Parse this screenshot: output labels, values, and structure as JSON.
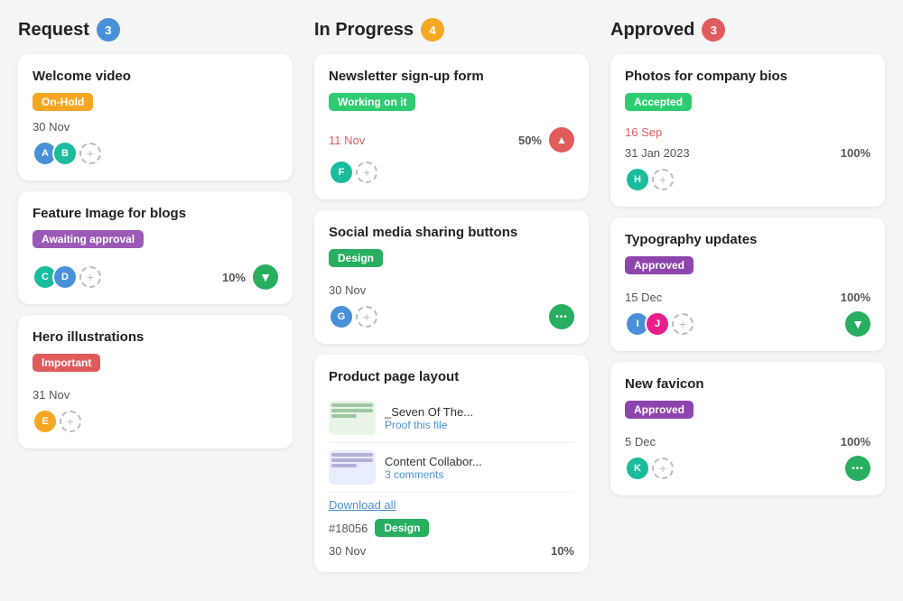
{
  "columns": [
    {
      "id": "request",
      "title": "Request",
      "badge_count": "3",
      "badge_color": "badge-blue",
      "cards": [
        {
          "id": "card-welcome-video",
          "title": "Welcome video",
          "tag_label": "On-Hold",
          "tag_color": "tag-orange",
          "date": "30 Nov",
          "date_style": "dark",
          "avatars": [
            {
              "color": "avatar-blue",
              "initial": "A"
            },
            {
              "color": "avatar-teal",
              "initial": "B"
            }
          ],
          "show_add": true,
          "show_percent": false,
          "percent": "",
          "icon": null
        },
        {
          "id": "card-feature-image",
          "title": "Feature Image for blogs",
          "tag_label": "Awaiting approval",
          "tag_color": "tag-purple",
          "date": "30 Nov",
          "date_style": "dark",
          "avatars": [
            {
              "color": "avatar-teal",
              "initial": "C"
            },
            {
              "color": "avatar-blue",
              "initial": "D"
            }
          ],
          "show_add": true,
          "show_percent": true,
          "percent": "10%",
          "icon": "down"
        },
        {
          "id": "card-hero-illustrations",
          "title": "Hero illustrations",
          "tag_label": "Important",
          "tag_color": "tag-red",
          "date": "31 Nov",
          "date_style": "dark",
          "avatars": [
            {
              "color": "avatar-orange",
              "initial": "E"
            }
          ],
          "show_add": true,
          "show_percent": false,
          "percent": "",
          "icon": null
        }
      ]
    },
    {
      "id": "in-progress",
      "title": "In Progress",
      "badge_count": "4",
      "badge_color": "badge-orange",
      "cards": [
        {
          "id": "card-newsletter",
          "title": "Newsletter sign-up form",
          "tag_label": "Working on it",
          "tag_color": "tag-green2",
          "date": "11 Nov",
          "date_style": "red",
          "avatars": [
            {
              "color": "avatar-teal",
              "initial": "F"
            }
          ],
          "show_add": true,
          "show_percent": true,
          "percent": "50%",
          "icon": "up"
        },
        {
          "id": "card-social-media",
          "title": "Social media sharing buttons",
          "tag_label": "Design",
          "tag_color": "tag-green",
          "date": "30 Nov",
          "date_style": "dark",
          "avatars": [
            {
              "color": "avatar-blue",
              "initial": "G"
            }
          ],
          "show_add": true,
          "show_percent": false,
          "percent": "",
          "icon": "dots"
        },
        {
          "id": "card-product-page",
          "title": "Product page layout",
          "tag_label": null,
          "date": "30 Nov",
          "date_style": "dark",
          "show_add": false,
          "show_percent": true,
          "percent": "10%",
          "icon": null,
          "ticket_id": "#18056",
          "ticket_tag": "Design",
          "download_label": "Download all",
          "attachments": [
            {
              "name": "_Seven Of The...",
              "action": "Proof this file",
              "type": "green"
            },
            {
              "name": "Content Collabor...",
              "action": "3 comments",
              "type": "blue"
            }
          ]
        }
      ]
    },
    {
      "id": "approved",
      "title": "Approved",
      "badge_count": "3",
      "badge_color": "badge-red",
      "cards": [
        {
          "id": "card-photos",
          "title": "Photos for company bios",
          "tag_label": "Accepted",
          "tag_color": "tag-accepted",
          "date": "16 Sep",
          "date_style": "red",
          "date2": "31 Jan 2023",
          "avatars": [
            {
              "color": "avatar-teal",
              "initial": "H"
            }
          ],
          "show_add": true,
          "show_percent": true,
          "percent": "100%",
          "icon": null
        },
        {
          "id": "card-typography",
          "title": "Typography updates",
          "tag_label": "Approved",
          "tag_color": "tag-approved",
          "date": "15 Dec",
          "date_style": "dark",
          "avatars": [
            {
              "color": "avatar-blue",
              "initial": "I"
            },
            {
              "color": "avatar-pink",
              "initial": "J"
            }
          ],
          "show_add": true,
          "show_percent": true,
          "percent": "100%",
          "icon": "down"
        },
        {
          "id": "card-new-favicon",
          "title": "New favicon",
          "tag_label": "Approved",
          "tag_color": "tag-approved",
          "date": "5 Dec",
          "date_style": "dark",
          "avatars": [
            {
              "color": "avatar-teal",
              "initial": "K"
            }
          ],
          "show_add": true,
          "show_percent": true,
          "percent": "100%",
          "icon": "dots"
        }
      ]
    }
  ]
}
